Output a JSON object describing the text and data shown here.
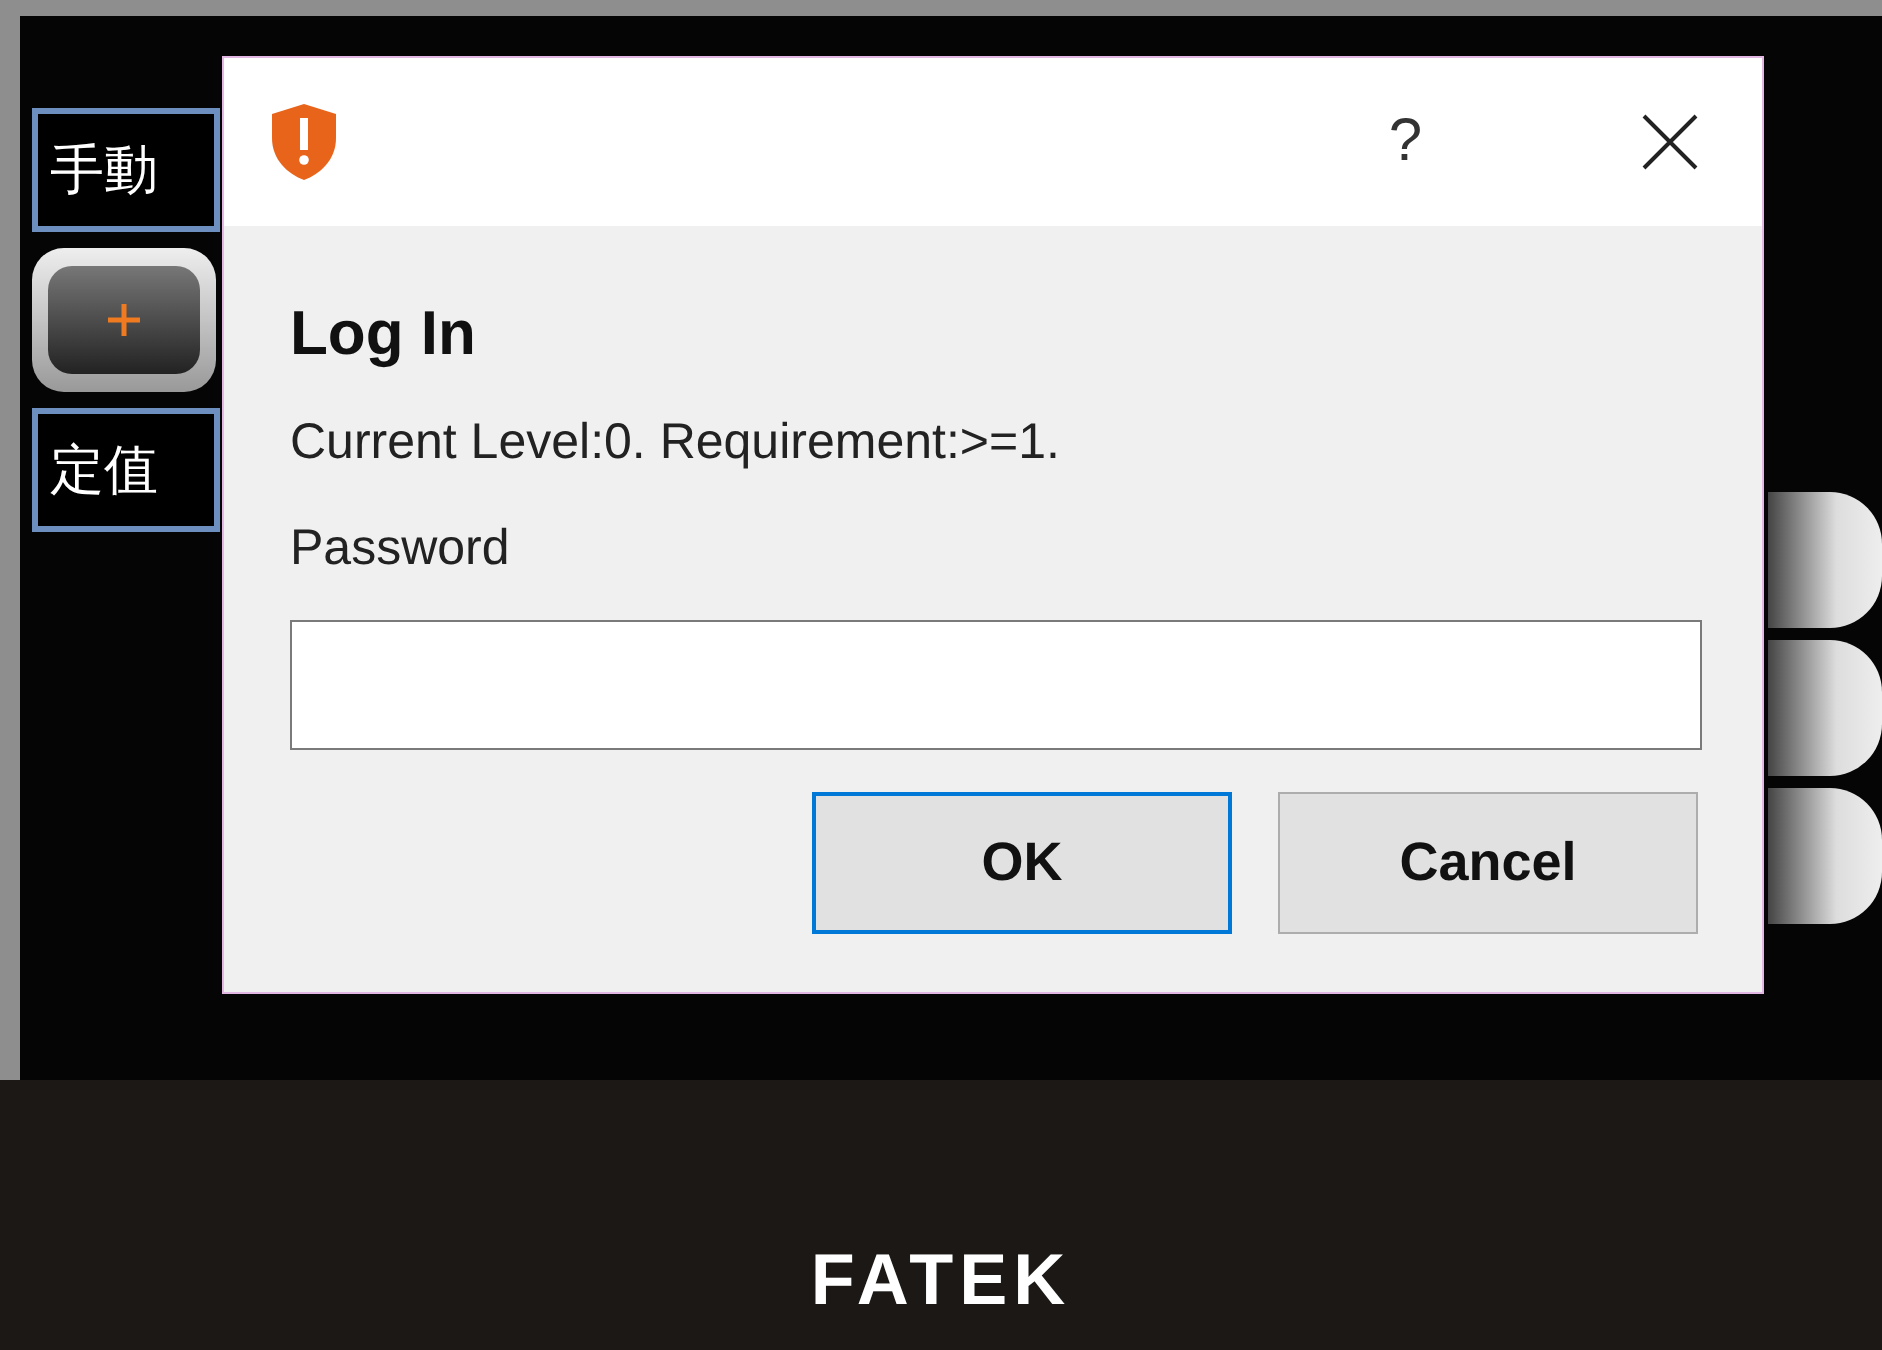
{
  "hmi": {
    "left_items": [
      {
        "kind": "label",
        "text": "手動"
      },
      {
        "kind": "button"
      },
      {
        "kind": "label",
        "text": "定值"
      }
    ],
    "right_items": [
      {
        "kind": "button"
      },
      {
        "kind": "button"
      },
      {
        "kind": "button"
      }
    ]
  },
  "footer": {
    "brand": "FATEK"
  },
  "dialog": {
    "help": "?",
    "heading": "Log In",
    "message": "Current Level:0. Requirement:>=1.",
    "password_label": "Password",
    "buttons": [
      {
        "label": "OK",
        "focused": true
      },
      {
        "label": "Cancel",
        "focused": false
      }
    ]
  }
}
